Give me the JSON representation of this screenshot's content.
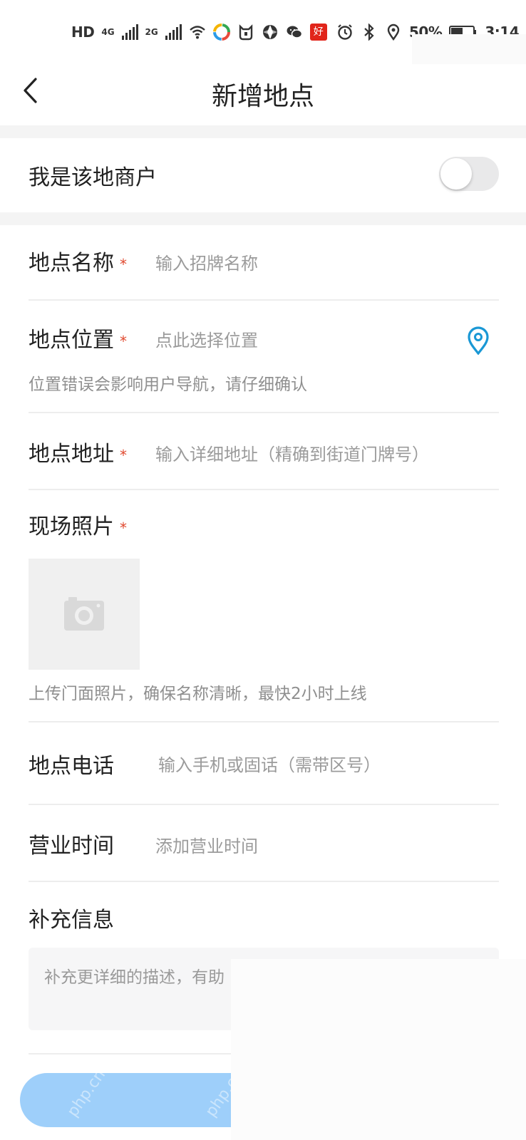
{
  "status_bar": {
    "hd_label": "HD",
    "net1": "4G",
    "net2": "2G",
    "badge_text": "好",
    "battery": "50%",
    "time": "3:14",
    "icons": [
      "hd-icon",
      "signal-icon",
      "wifi-icon",
      "app-icon",
      "bluetooth-icon",
      "location-icon",
      "battery-icon",
      "alarm-icon",
      "wechat-icon"
    ]
  },
  "header": {
    "title": "新增地点"
  },
  "merchant": {
    "label": "我是该地商户",
    "toggle_on": false
  },
  "form": {
    "name": {
      "label": "地点名称",
      "required": "*",
      "placeholder": "输入招牌名称"
    },
    "position": {
      "label": "地点位置",
      "required": "*",
      "placeholder": "点此选择位置",
      "hint": "位置错误会影响用户导航，请仔细确认"
    },
    "address": {
      "label": "地点地址",
      "required": "*",
      "placeholder": "输入详细地址（精确到街道门牌号）"
    },
    "photo": {
      "label": "现场照片",
      "required": "*",
      "hint": "上传门面照片，确保名称清晰，最快2小时上线"
    },
    "phone": {
      "label": "地点电话",
      "placeholder": "输入手机或固话（需带区号）"
    },
    "hours": {
      "label": "营业时间",
      "placeholder": "添加营业时间"
    },
    "supplement": {
      "label": "补充信息",
      "placeholder": "补充更详细的描述，有助"
    }
  },
  "colors": {
    "accent": "#1a98d5",
    "required": "#e0492f",
    "submit_bg": "#9ecffa",
    "toggle_off": "#e9e9ea",
    "divider": "#ededed"
  }
}
